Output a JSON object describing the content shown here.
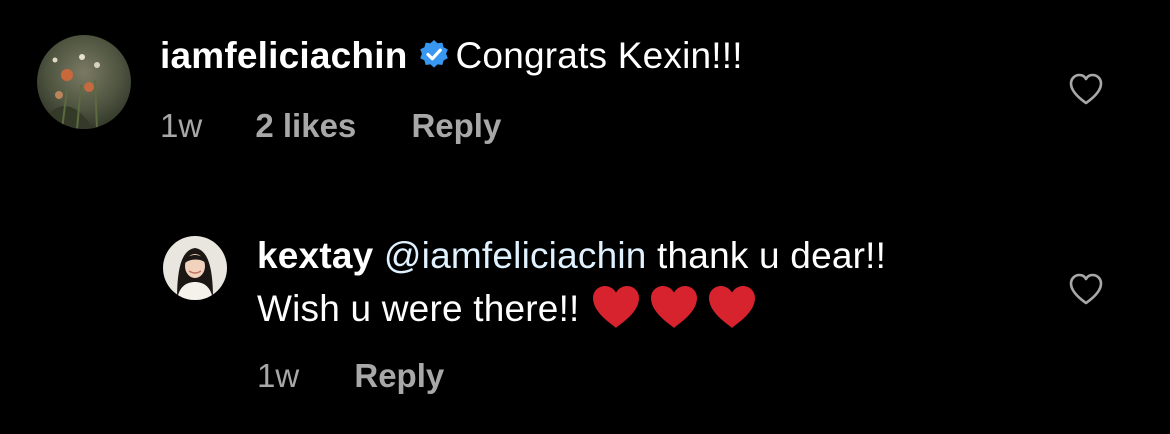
{
  "comments": [
    {
      "username": "iamfeliciachin",
      "verified": true,
      "text": "Congrats Kexin!!!",
      "time": "1w",
      "likes": "2 likes",
      "reply_label": "Reply"
    },
    {
      "username": "kextay",
      "mention": "@iamfeliciachin",
      "text_line1": "thank u dear!!",
      "text_line2": "Wish u were there!!",
      "emoji": [
        "red-heart",
        "red-heart",
        "red-heart"
      ],
      "time": "1w",
      "reply_label": "Reply"
    }
  ],
  "colors": {
    "background": "#000000",
    "text": "#ffffff",
    "meta": "#a8a8a8",
    "mention": "#e0f1ff",
    "verified_badge": "#3897f0",
    "heart_emoji": "#d6232e"
  },
  "icons": {
    "verified": "verified-badge-icon",
    "like": "heart-outline-icon"
  }
}
